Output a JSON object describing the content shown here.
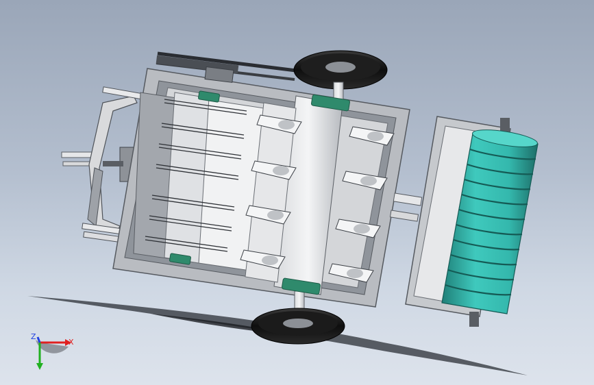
{
  "viewport": {
    "background_top": "#9aa6b8",
    "background_bottom": "#dde3ec"
  },
  "model": {
    "frame_color": "#c9cbcf",
    "frame_dark": "#6e7278",
    "wheel_color": "#151515",
    "bearing_color": "#2f8a6c",
    "roller_color": "#34b8ad",
    "roller_groove": "#1f6f69"
  },
  "triad": {
    "x_label": "X",
    "z_label": "Z",
    "x_color": "#e02020",
    "y_color": "#20b020",
    "z_color": "#2040e0"
  }
}
